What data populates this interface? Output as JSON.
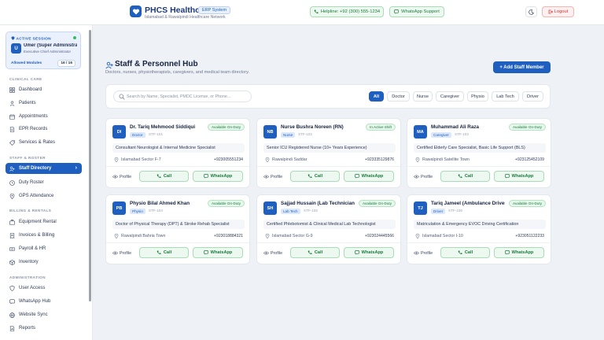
{
  "header": {
    "brand": "PHCS Healthcare",
    "badge": "ERP System",
    "subtitle": "Islamabad & Rawalpindi Healthcare Network",
    "helpline": "Helpline: +92 (300) 555-1234",
    "whatsapp": "WhatsApp Support",
    "logout": "Logout"
  },
  "session": {
    "label": "ACTIVE SESSION",
    "initial": "U",
    "name": "Umer (Super Administrator)",
    "role": "Executive Chief Administrator",
    "modules_label": "Allowed Modules",
    "modules_count": "16 / 16"
  },
  "sidebar": {
    "sections": [
      {
        "title": "CLINICAL CARE",
        "items": [
          {
            "label": "Dashboard",
            "icon": "dashboard-icon"
          },
          {
            "label": "Patients",
            "icon": "patients-icon"
          },
          {
            "label": "Appointments",
            "icon": "calendar-icon"
          },
          {
            "label": "EPR Records",
            "icon": "document-icon"
          },
          {
            "label": "Services & Rates",
            "icon": "services-icon"
          }
        ]
      },
      {
        "title": "STAFF & ROSTER",
        "items": [
          {
            "label": "Staff Directory",
            "icon": "staff-icon",
            "active": true
          },
          {
            "label": "Duty Roster",
            "icon": "clock-icon"
          },
          {
            "label": "GPS Attendance",
            "icon": "location-icon"
          }
        ]
      },
      {
        "title": "BILLING & RENTALS",
        "items": [
          {
            "label": "Equipment Rental",
            "icon": "equipment-icon"
          },
          {
            "label": "Invoices & Billing",
            "icon": "invoice-icon"
          },
          {
            "label": "Payroll & HR",
            "icon": "payroll-icon"
          },
          {
            "label": "Inventory",
            "icon": "inventory-icon"
          }
        ]
      },
      {
        "title": "ADMINISTRATION",
        "items": [
          {
            "label": "User Access",
            "icon": "user-access-icon"
          },
          {
            "label": "WhatsApp Hub",
            "icon": "whatsapp-icon"
          },
          {
            "label": "Website Sync",
            "icon": "globe-icon"
          },
          {
            "label": "Reports",
            "icon": "reports-icon"
          }
        ]
      }
    ]
  },
  "page": {
    "title": "Staff & Personnel Hub",
    "subtitle": "Doctors, nurses, physiotherapists, caregivers, and medical team directory.",
    "add_button": "+ Add Staff Member"
  },
  "filters": {
    "search_placeholder": "Search by Name, Specialist, PMDC License, or Phone...",
    "chips": [
      "All",
      "Doctor",
      "Nurse",
      "Caregiver",
      "Physio",
      "Lab Tech",
      "Driver"
    ],
    "selected": "All"
  },
  "staff": [
    {
      "initials": "DI",
      "name": "Dr. Tariq Mehmood Siddiqui",
      "role": "Doctor",
      "id": "STF-101",
      "status": "Available On-Duty",
      "specialty": "Consultant Neurologist & Internal Medicine Specialist",
      "location": "Islamabad Sector F-7",
      "phone": "+923005551234"
    },
    {
      "initials": "NB",
      "name": "Nurse Bushra Noreen (RN)",
      "role": "Nurse",
      "id": "STF-102",
      "status": "In Active Shift",
      "specialty": "Senior ICU Registered Nurse (10+ Years Experience)",
      "location": "Rawalpindi Saddar",
      "phone": "+923335129876"
    },
    {
      "initials": "MA",
      "name": "Muhammad Ali Raza",
      "role": "Caregiver",
      "id": "STF-103",
      "status": "Available On-Duty",
      "specialty": "Certified Elderly Care Specialist, Basic Life Support (BLS)",
      "location": "Rawalpindi Satellite Town",
      "phone": "+923125452109"
    },
    {
      "initials": "PB",
      "name": "Physio Bilal Ahmed Khan",
      "role": "Physio",
      "id": "STF-104",
      "status": "Available On-Duty",
      "specialty": "Doctor of Physical Therapy (DPT) & Stroke Rehab Specialist",
      "location": "Rawalpindi Bahria Town",
      "phone": "+923018884321"
    },
    {
      "initials": "SH",
      "name": "Sajjad Hussain (Lab Technician)",
      "role": "Lab Tech",
      "id": "STF-105",
      "status": "Available On-Duty",
      "specialty": "Certified Phlebotomist & Clinical Medical Lab Technologist",
      "location": "Islamabad Sector G-9",
      "phone": "+923024445566"
    },
    {
      "initials": "TJ",
      "name": "Tariq Jameel (Ambulance Driver)",
      "role": "Driver",
      "id": "STF-106",
      "status": "Available On-Duty",
      "specialty": "Matriculation & Emergency EVOC Driving Certification",
      "location": "Islamabad Sector I-10",
      "phone": "+923051122233"
    }
  ],
  "card_actions": {
    "profile": "Profile",
    "call": "Call",
    "whatsapp": "WhatsApp"
  },
  "colors": {
    "primary": "#1f5fbf",
    "success": "#1a7a3d",
    "danger": "#d03434"
  }
}
